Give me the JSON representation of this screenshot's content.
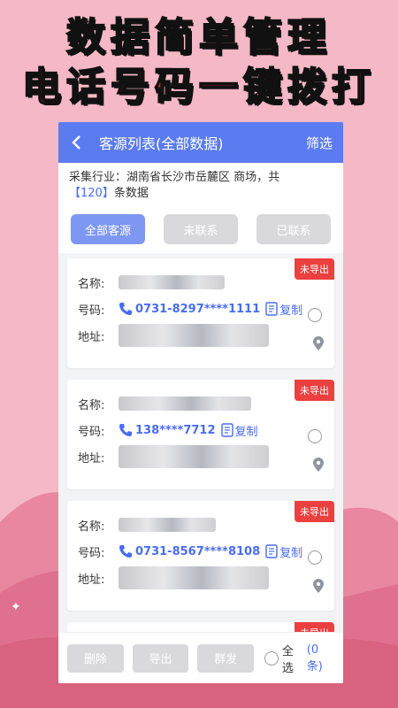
{
  "promo": {
    "line1": "数据简单管理",
    "line2": "电话号码一键拨打"
  },
  "header": {
    "title": "客源列表(全部数据)",
    "filter_label": "筛选"
  },
  "info": {
    "prefix": "采集行业：湖南省长沙市岳麓区 商场，共",
    "count": "【120】",
    "suffix": "条数据"
  },
  "tabs": [
    {
      "label": "全部客源",
      "active": true
    },
    {
      "label": "未联系",
      "active": false
    },
    {
      "label": "已联系",
      "active": false
    }
  ],
  "labels": {
    "name": "名称:",
    "number": "号码:",
    "address": "地址:",
    "copy": "复制"
  },
  "cards": [
    {
      "badge": "未导出",
      "phone": "0731-8297****1111"
    },
    {
      "badge": "未导出",
      "phone": "138****7712"
    },
    {
      "badge": "未导出",
      "phone": "0731-8567****8108"
    },
    {
      "badge": "未导出"
    }
  ],
  "bottom": {
    "delete_label": "删除",
    "export_label": "导出",
    "broadcast_label": "群发",
    "select_all_label": "全选",
    "selected_count": "(0条)"
  },
  "colors": {
    "accent": "#5b7bf0",
    "badge": "#ec3f3f",
    "headline": "#e8243b",
    "background": "#f5b8c6"
  }
}
